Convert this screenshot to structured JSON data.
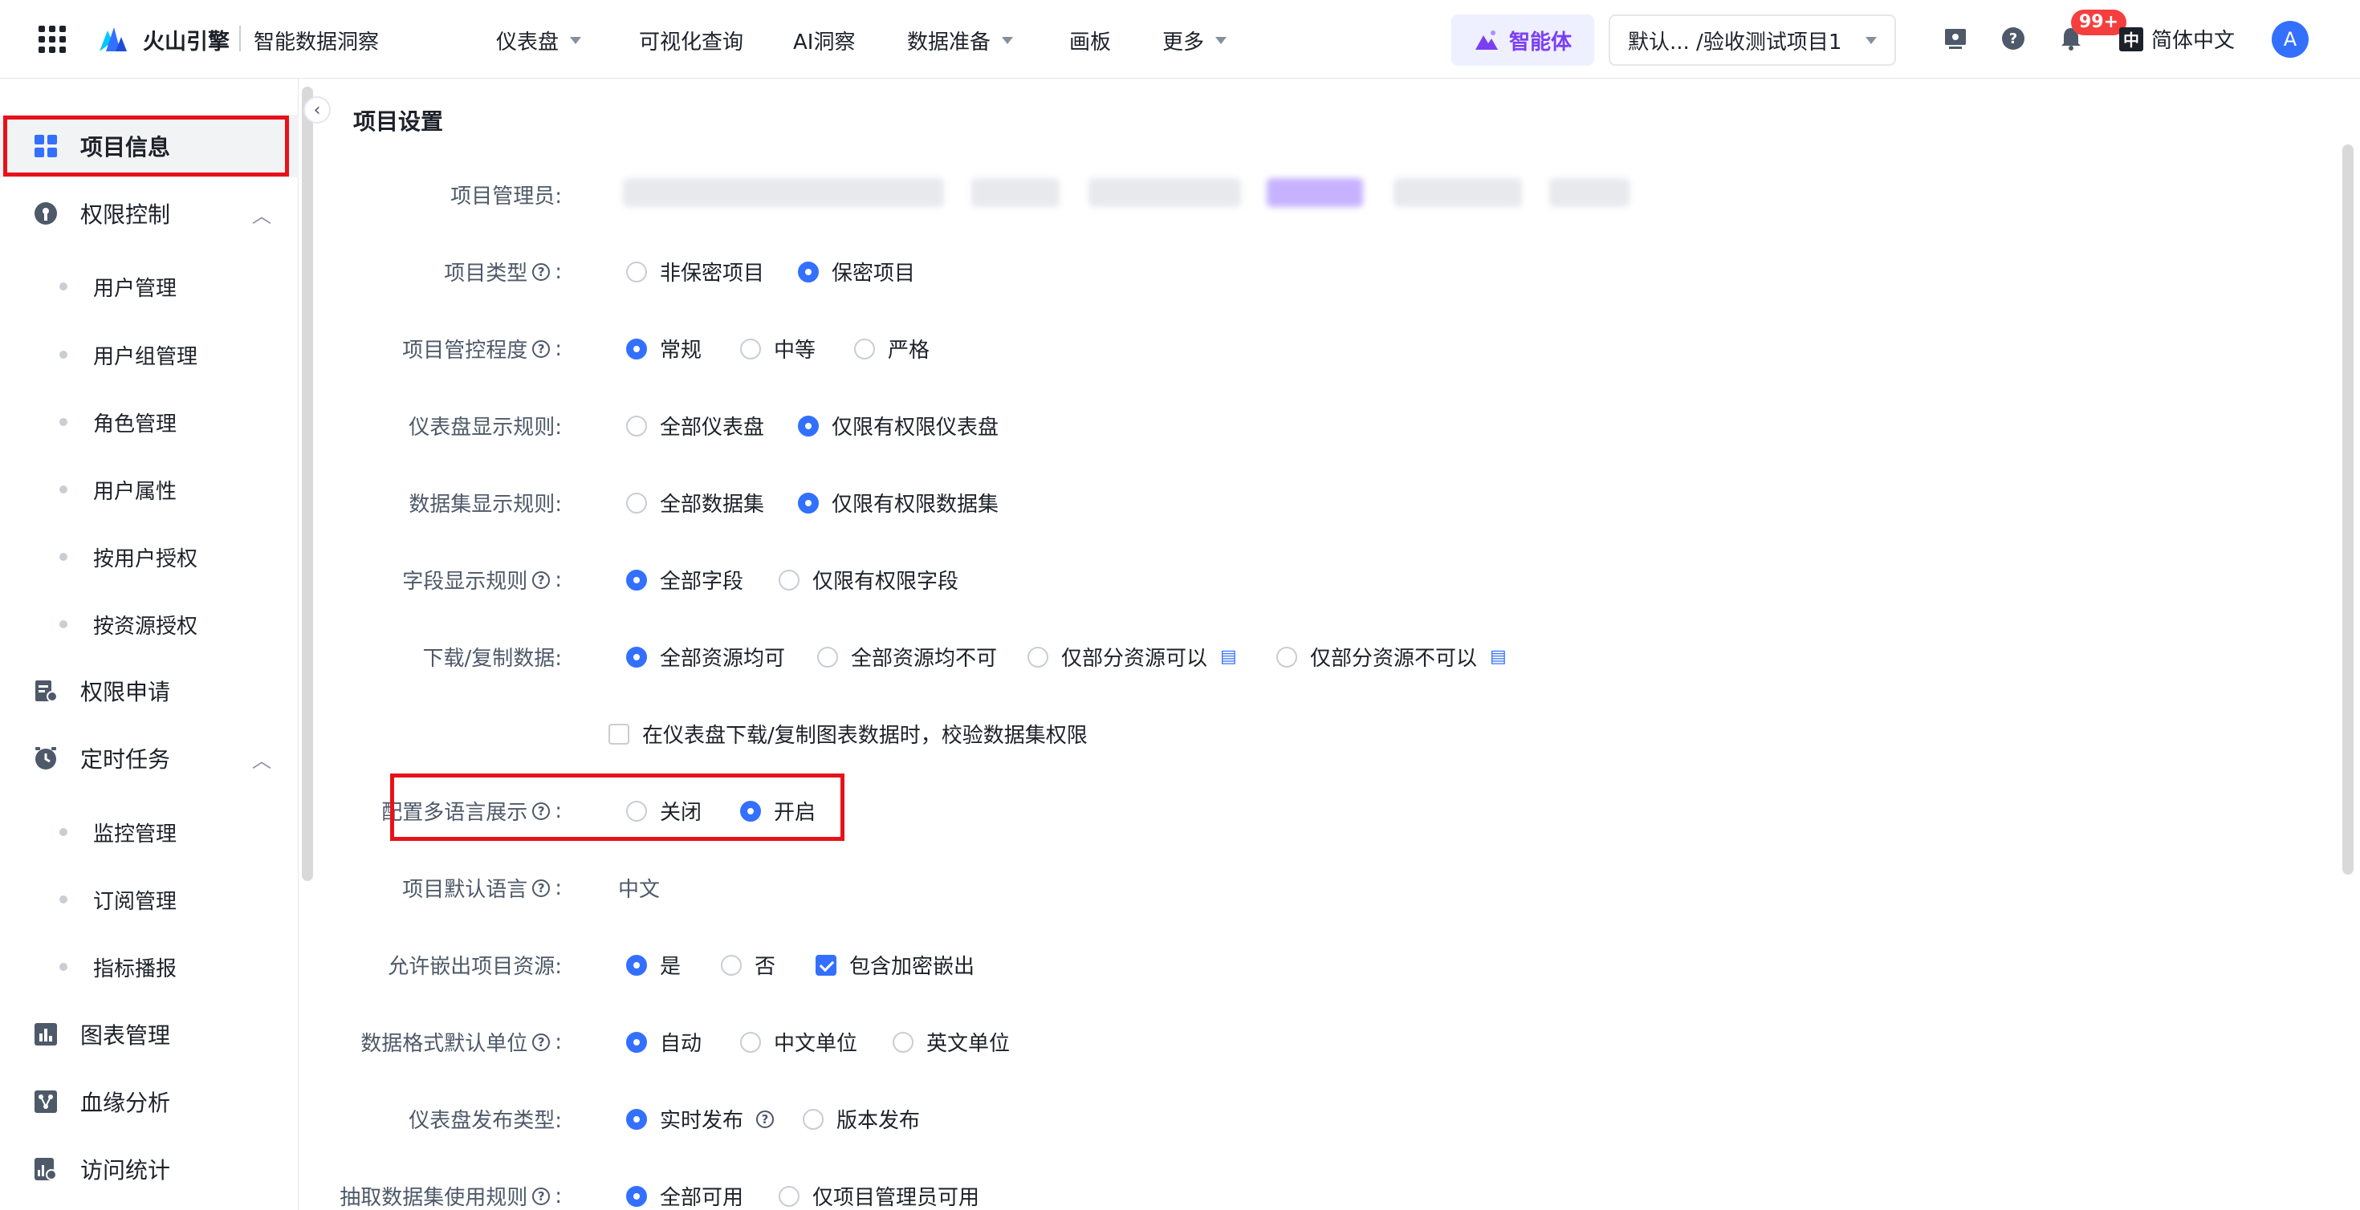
{
  "header": {
    "brand": "火山引擎",
    "product": "智能数据洞察",
    "nav": [
      {
        "label": "仪表盘",
        "dropdown": true
      },
      {
        "label": "可视化查询",
        "dropdown": false
      },
      {
        "label": "AI洞察",
        "dropdown": false
      },
      {
        "label": "数据准备",
        "dropdown": true
      },
      {
        "label": "画板",
        "dropdown": false
      },
      {
        "label": "更多",
        "dropdown": true
      }
    ],
    "agent_label": "智能体",
    "project_select": "默认...   /验收测试项目1",
    "notification_count": "99+",
    "language_icon": "中",
    "language": "简体中文",
    "avatar": "A"
  },
  "sidebar": {
    "items": [
      {
        "label": "项目信息",
        "icon": "grid-icon",
        "active": true
      },
      {
        "label": "权限控制",
        "icon": "shield-icon",
        "expanded": true,
        "children": [
          "用户管理",
          "用户组管理",
          "角色管理",
          "用户属性",
          "按用户授权",
          "按资源授权"
        ]
      },
      {
        "label": "权限申请",
        "icon": "apply-icon"
      },
      {
        "label": "定时任务",
        "icon": "clock-icon",
        "expanded": true,
        "children": [
          "监控管理",
          "订阅管理",
          "指标播报"
        ]
      },
      {
        "label": "图表管理",
        "icon": "chart-icon"
      },
      {
        "label": "血缘分析",
        "icon": "lineage-icon"
      },
      {
        "label": "访问统计",
        "icon": "stats-icon"
      }
    ]
  },
  "main": {
    "title": "项目设置",
    "rows": {
      "admins": {
        "label": "项目管理员:"
      },
      "type": {
        "label": "项目类型",
        "options": [
          "非保密项目",
          "保密项目"
        ],
        "selected": 1
      },
      "control": {
        "label": "项目管控程度",
        "options": [
          "常规",
          "中等",
          "严格"
        ],
        "selected": 0
      },
      "dashboard_rule": {
        "label": "仪表盘显示规则:",
        "options": [
          "全部仪表盘",
          "仅限有权限仪表盘"
        ],
        "selected": 1
      },
      "dataset_rule": {
        "label": "数据集显示规则:",
        "options": [
          "全部数据集",
          "仅限有权限数据集"
        ],
        "selected": 1
      },
      "field_rule": {
        "label": "字段显示规则",
        "options": [
          "全部字段",
          "仅限有权限字段"
        ],
        "selected": 0
      },
      "download": {
        "label": "下载/复制数据:",
        "options": [
          "全部资源均可",
          "全部资源均不可",
          "仅部分资源可以",
          "仅部分资源不可以"
        ],
        "selected": 0
      },
      "download_check": {
        "label": "在仪表盘下载/复制图表数据时，校验数据集权限",
        "checked": false
      },
      "multilang": {
        "label": "配置多语言展示",
        "options": [
          "关闭",
          "开启"
        ],
        "selected": 1
      },
      "default_lang": {
        "label": "项目默认语言",
        "value": "中文"
      },
      "embed": {
        "label": "允许嵌出项目资源:",
        "options": [
          "是",
          "否"
        ],
        "selected": 0,
        "checkbox_label": "包含加密嵌出",
        "checkbox_checked": true
      },
      "unit": {
        "label": "数据格式默认单位",
        "options": [
          "自动",
          "中文单位",
          "英文单位"
        ],
        "selected": 0
      },
      "publish": {
        "label": "仪表盘发布类型:",
        "options": [
          "实时发布",
          "版本发布"
        ],
        "selected": 0
      },
      "extract": {
        "label": "抽取数据集使用规则",
        "options": [
          "全部可用",
          "仅项目管理员可用"
        ],
        "selected": 0
      }
    }
  },
  "colors": {
    "accent": "#3370ff",
    "highlight": "#e8111a",
    "agent": "#7b3ff2"
  }
}
